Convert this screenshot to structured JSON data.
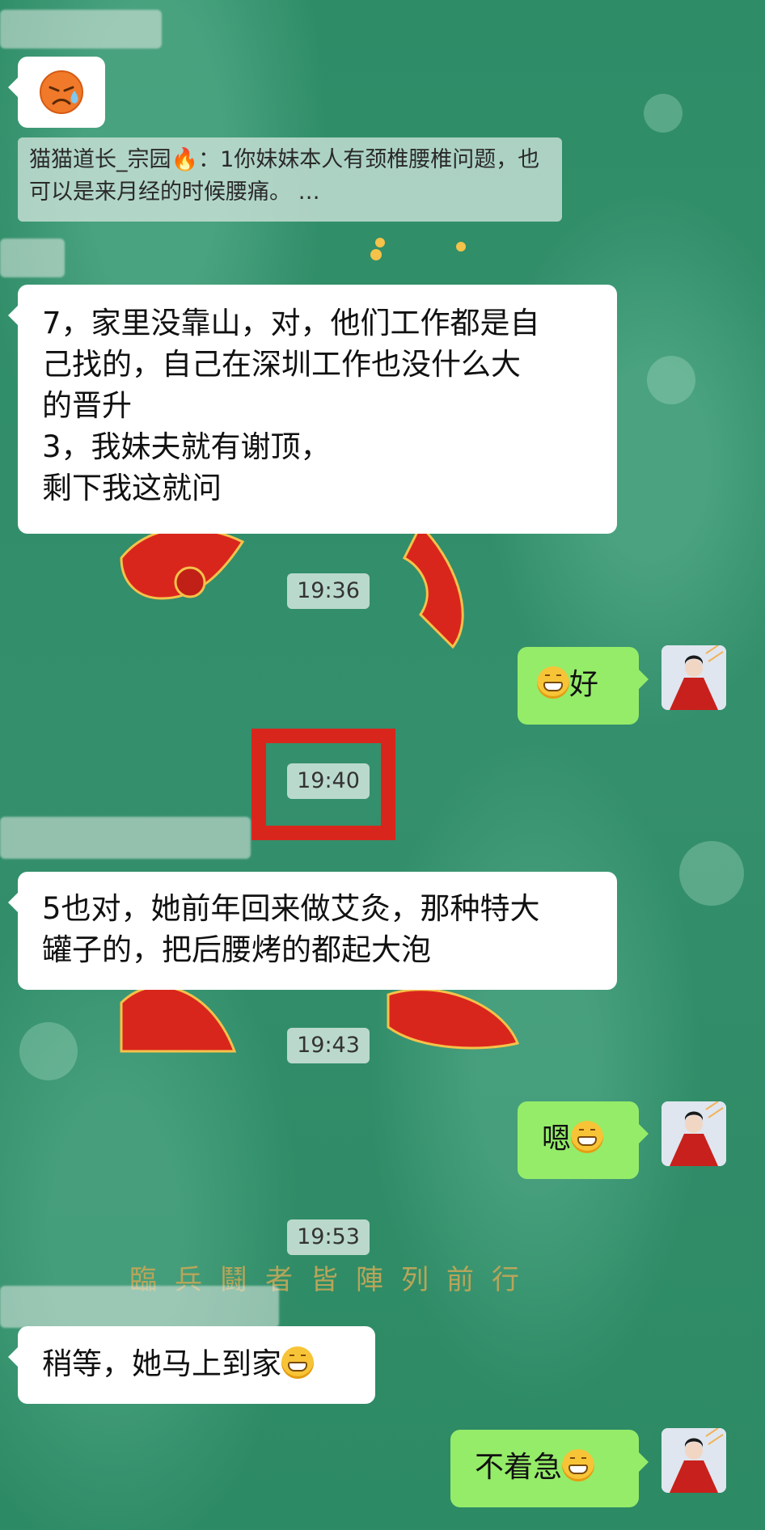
{
  "chat": {
    "quote": {
      "text": "猫猫道长_宗园🔥：1你妹妹本人有颈椎腰椎问题，也可以是来月经的时候腰痛。 …"
    },
    "messages": [
      {
        "text_line1": "7，家里没靠山，对，他们工作都是自",
        "text_line2": "己找的，自己在深圳工作也没什么大",
        "text_line3": "的晋升",
        "text_line4": "3，我妹夫就有谢顶，",
        "text_line5": "剩下我这就问"
      },
      {
        "time": "19:36"
      },
      {
        "text": "好"
      },
      {
        "time": "19:40"
      },
      {
        "text_line1": "5也对，她前年回来做艾灸，那种特大",
        "text_line2": "罐子的，把后腰烤的都起大泡"
      },
      {
        "time": "19:43"
      },
      {
        "text": "嗯"
      },
      {
        "time": "19:53"
      },
      {
        "text": "稍等，她马上到家"
      },
      {
        "text": "不着急"
      }
    ]
  },
  "background_text": {
    "line": "臨兵鬪者皆陣列前行"
  },
  "colors": {
    "background": "#2f8f6a",
    "incoming_bubble": "#ffffff",
    "outgoing_bubble": "#95ec69"
  },
  "icons": [
    "sad-sweat-emoji-icon",
    "grin-emoji-icon",
    "avatar-icon"
  ]
}
